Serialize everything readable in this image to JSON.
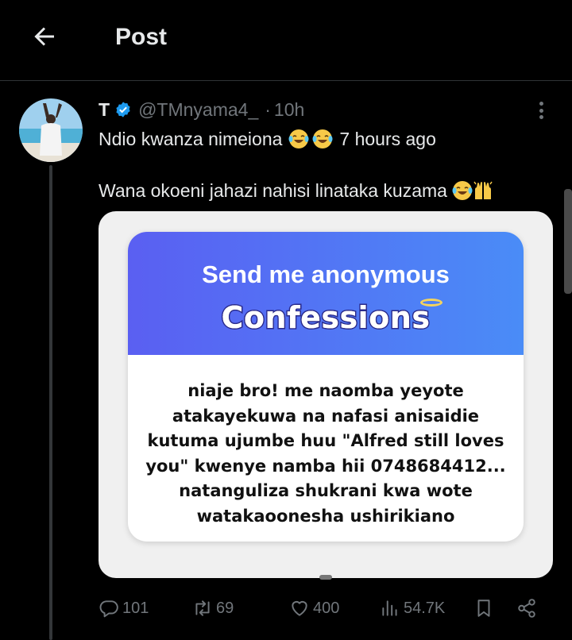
{
  "header": {
    "title": "Post",
    "back_icon": "arrow-left-icon"
  },
  "post": {
    "author_name": "T",
    "verified": true,
    "handle": "@TMnyama4_",
    "separator": "·",
    "time": "10h",
    "line1": "Ndio kwanza nimeiona",
    "line1_suffix": "7 hours ago",
    "line2": "Wana okoeni jahazi nahisi linataka kuzama",
    "emojis": [
      "face-with-tears-of-joy",
      "face-with-tears-of-joy",
      "face-with-tears-of-joy",
      "raising-hands"
    ]
  },
  "media": {
    "title": "Send me anonymous",
    "subtitle": "Confessions",
    "body_lines": [
      "niaje bro! me naomba yeyote",
      "atakayekuwa na nafasi anisaidie",
      "kutuma ujumbe huu \"Alfred still loves",
      "you\" kwenye namba hii 0748684412...",
      "natanguliza shukrani kwa wote",
      "watakaoonesha ushirikiano"
    ]
  },
  "actions": {
    "replies": "101",
    "reposts": "69",
    "likes": "400",
    "views": "54.7K"
  },
  "colors": {
    "background": "#000000",
    "muted": "#71767b",
    "verified": "#1d9bf0",
    "card_gradient_start": "#5a5ff2",
    "card_gradient_end": "#4a8cf7"
  }
}
